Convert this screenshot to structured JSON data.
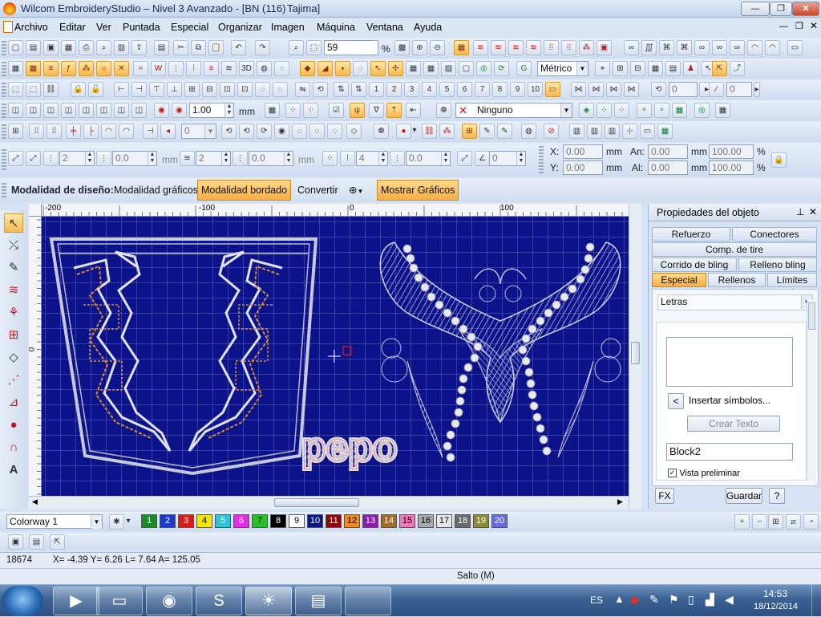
{
  "window": {
    "title": "Wilcom EmbroideryStudio – Nivel 3 Avanzado - [BN (116)",
    "machine": "Tajima]",
    "controls": {
      "minimize": "—",
      "restore": "❐",
      "close": "✕"
    }
  },
  "menu": [
    "Archivo",
    "Editar",
    "Ver",
    "Puntada",
    "Especial",
    "Organizar",
    "Imagen",
    "Máquina",
    "Ventana",
    "Ayuda"
  ],
  "toolbar1": {
    "zoom_value": "59",
    "zoom_unit": "%"
  },
  "toolbar2": {
    "units": "Métrico"
  },
  "toolbar3": {
    "angle1": "0",
    "angle2": "0"
  },
  "toolbar4": {
    "width_value": "1.00",
    "width_unit": "mm",
    "connector": "Ninguno"
  },
  "toolbar5": {
    "value": "0"
  },
  "toolbar6": {
    "f1": "2",
    "f2": "0.0",
    "u1": "mm",
    "f3": "2",
    "f4": "0.0",
    "u2": "mm",
    "f5": "4",
    "f6": "0.0",
    "f7": "0"
  },
  "transform": {
    "x_label": "X:",
    "x_value": "0.00",
    "x_unit": "mm",
    "y_label": "Y:",
    "y_value": "0.00",
    "y_unit": "mm",
    "w_label": "An:",
    "w_value": "0.00",
    "w_unit": "mm",
    "w_pct": "100.00",
    "w_pct_unit": "%",
    "h_label": "Al:",
    "h_value": "0.00",
    "h_unit": "mm",
    "h_pct": "100.00",
    "h_pct_unit": "%"
  },
  "modebar": {
    "label": "Modalidad de diseño:",
    "graphics_mode": "Modalidad gráficos",
    "embroidery_mode": "Modalidad bordado",
    "convert": "Convertir",
    "show_graphics": "Mostrar Gráficos"
  },
  "rulers": {
    "h_ticks": [
      "-200",
      "-100",
      "0",
      "100"
    ],
    "v_ticks": [
      "0"
    ]
  },
  "design": {
    "text": "pepo",
    "background": "#0b128a",
    "grid": "#5a66c0"
  },
  "panel": {
    "title": "Propiedades del objeto",
    "tabs_row1": [
      "Refuerzo",
      "Conectores"
    ],
    "tabs_row2": [
      "Comp. de tire"
    ],
    "tabs_row3": [
      "Corrido de bling",
      "Relleno bling"
    ],
    "tabs_row4": [
      "Especial",
      "Rellenos",
      "Límites"
    ],
    "type": "Letras",
    "insert_symbols": "Insertar símbolos...",
    "create_text": "Crear Texto",
    "font_name": "Block2",
    "preview_label": "Vista preliminar",
    "fx": "FX",
    "save": "Guardar",
    "help": "?"
  },
  "colorway": {
    "name": "Colorway 1",
    "swatches": [
      {
        "n": "1",
        "c": "#1a8a2a",
        "fg": "#fff"
      },
      {
        "n": "2",
        "c": "#1c3cc8",
        "fg": "#fff"
      },
      {
        "n": "3",
        "c": "#d81c1c",
        "fg": "#fff"
      },
      {
        "n": "4",
        "c": "#f5e600",
        "fg": "#000"
      },
      {
        "n": "5",
        "c": "#2cc4d8",
        "fg": "#fff"
      },
      {
        "n": "6",
        "c": "#e22ee2",
        "fg": "#fff"
      },
      {
        "n": "7",
        "c": "#27c227",
        "fg": "#000"
      },
      {
        "n": "8",
        "c": "#000000",
        "fg": "#fff"
      },
      {
        "n": "9",
        "c": "#ffffff",
        "fg": "#000"
      },
      {
        "n": "10",
        "c": "#0b1a7c",
        "fg": "#fff"
      },
      {
        "n": "11",
        "c": "#8a0a0a",
        "fg": "#fff"
      },
      {
        "n": "12",
        "c": "#f08a20",
        "fg": "#000"
      },
      {
        "n": "13",
        "c": "#8a1aa8",
        "fg": "#fff"
      },
      {
        "n": "14",
        "c": "#a06a2a",
        "fg": "#fff"
      },
      {
        "n": "15",
        "c": "#f07ab8",
        "fg": "#000"
      },
      {
        "n": "16",
        "c": "#a8a8a8",
        "fg": "#000"
      },
      {
        "n": "17",
        "c": "#e8e8e8",
        "fg": "#000"
      },
      {
        "n": "18",
        "c": "#6a6a6a",
        "fg": "#fff"
      },
      {
        "n": "19",
        "c": "#8a8a3a",
        "fg": "#fff"
      },
      {
        "n": "20",
        "c": "#6a6ae0",
        "fg": "#fff"
      }
    ]
  },
  "status": {
    "count": "18674",
    "coords": "X= -4.39 Y= 6.26 L= 7.64 A= 125.05",
    "jump": "Salto (M)"
  },
  "taskbar": {
    "lang": "ES",
    "time": "14:53",
    "date": "18/12/2014"
  }
}
